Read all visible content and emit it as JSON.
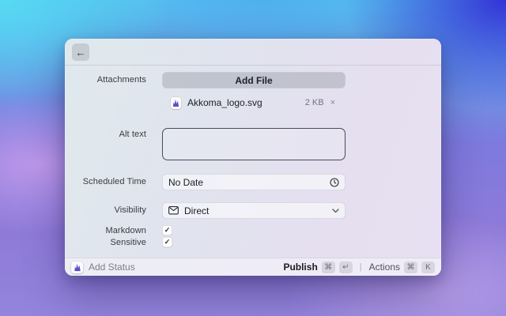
{
  "header": {
    "back_icon": "←"
  },
  "form": {
    "attachments_label": "Attachments",
    "add_file_button": "Add File",
    "attachment": {
      "name": "Akkoma_logo.svg",
      "size": "2 KB",
      "remove_icon": "×"
    },
    "alt_text_label": "Alt text",
    "alt_text_value": "",
    "scheduled_time_label": "Scheduled Time",
    "scheduled_time_value": "No Date",
    "visibility_label": "Visibility",
    "visibility_value": "Direct",
    "markdown_label": "Markdown",
    "sensitive_label": "Sensitive",
    "check_icon": "✓"
  },
  "footer": {
    "app_label": "Add Status",
    "publish_label": "Publish",
    "publish_keys": [
      "⌘",
      "↵"
    ],
    "group_divider": "|",
    "actions_label": "Actions",
    "actions_keys": [
      "⌘",
      "K"
    ]
  },
  "colors": {
    "brand_purple": "#5c4cc6",
    "wallpaper_cyan": "#57d9f3",
    "wallpaper_indigo": "#3432d6",
    "wallpaper_purple": "#8d7ad8"
  }
}
